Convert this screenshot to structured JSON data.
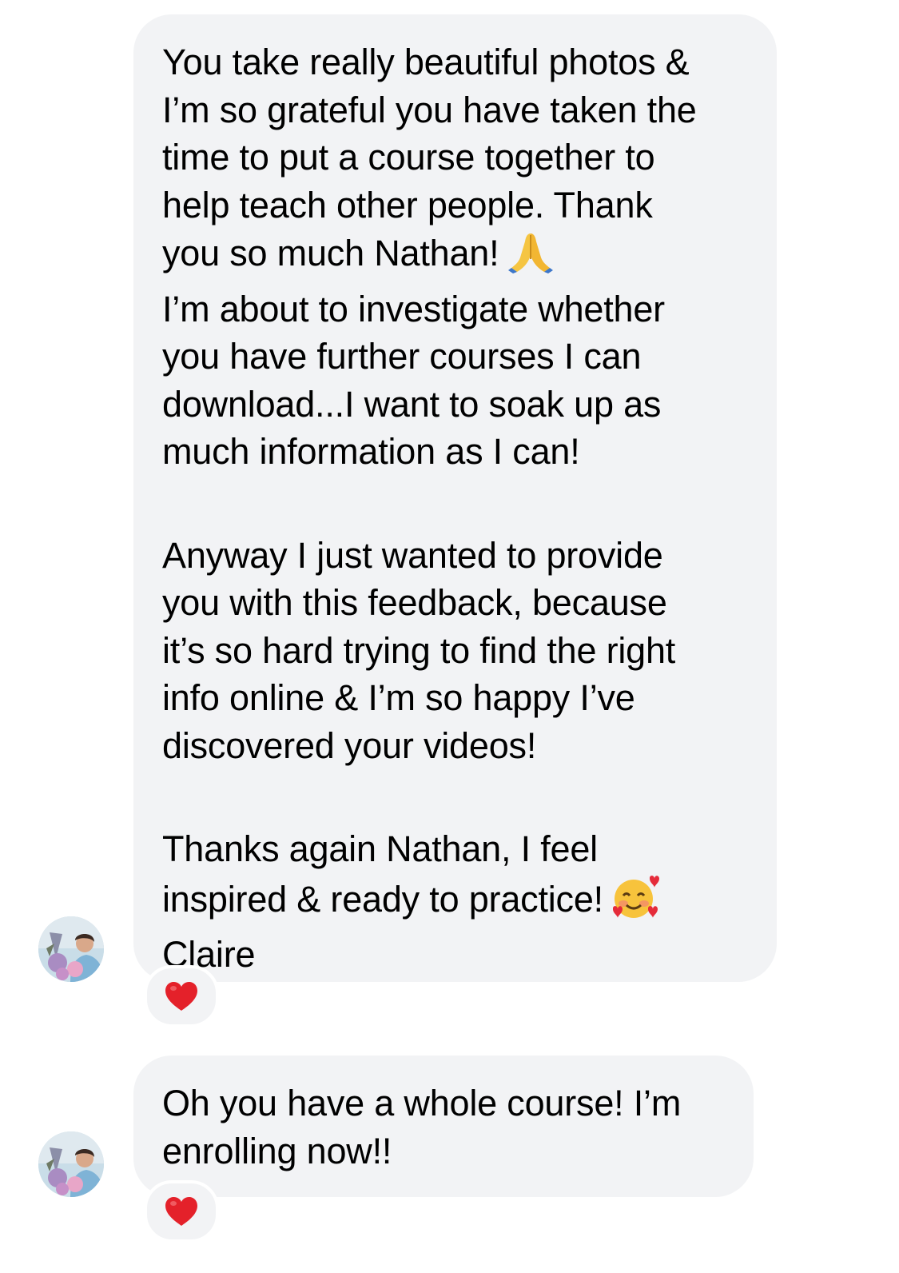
{
  "messages": [
    {
      "paragraphs": [
        {
          "lines": [
            "You take really beautiful photos &",
            "I’m so grateful you have taken the",
            "time to put a course together to",
            "help teach other people. Thank",
            "you so much Nathan!"
          ],
          "trailing_emoji": "folded-hands-emoji"
        },
        {
          "lines": [
            "I’m about to investigate whether",
            "you have further courses I can",
            "download...I want to soak up as",
            "much information as I can!"
          ]
        },
        {
          "lines": [
            "Anyway I just wanted to provide",
            "you with this feedback, because",
            "it’s so hard trying to find the right",
            "info online & I’m so happy I’ve",
            "discovered your videos!"
          ]
        },
        {
          "lines": [
            "Thanks again Nathan, I feel",
            "inspired & ready to practice!"
          ],
          "trailing_emoji": "smiling-face-with-hearts-emoji"
        },
        {
          "lines": [
            "Claire"
          ]
        }
      ],
      "reaction": "red-heart-emoji"
    },
    {
      "paragraphs": [
        {
          "lines": [
            "Oh you have a whole course! I’m",
            "enrolling now!!"
          ]
        }
      ],
      "reaction": "red-heart-emoji"
    }
  ],
  "colors": {
    "bubble_background": "#f2f3f5",
    "text": "#000000",
    "reaction_heart": "#e4212a"
  }
}
